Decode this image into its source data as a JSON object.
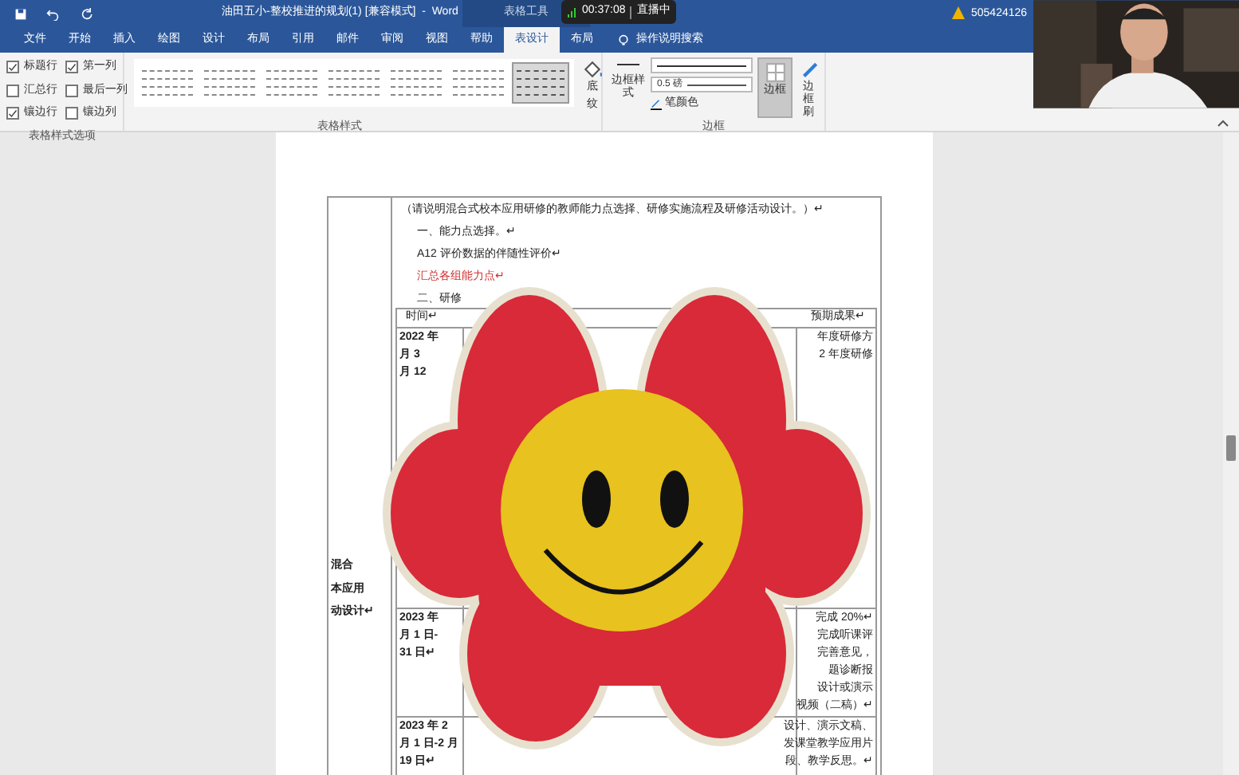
{
  "title_bar": {
    "title": "油田五小-整校推进的规划(1) [兼容模式]  -  Word",
    "context_tab": "表格工具",
    "recording": {
      "time": "00:37:08",
      "status": "直播中"
    },
    "account": "505424126"
  },
  "tabs": [
    {
      "label": "文件",
      "selected": false
    },
    {
      "label": "开始",
      "selected": false
    },
    {
      "label": "插入",
      "selected": false
    },
    {
      "label": "绘图",
      "selected": false
    },
    {
      "label": "设计",
      "selected": false
    },
    {
      "label": "布局",
      "selected": false
    },
    {
      "label": "引用",
      "selected": false
    },
    {
      "label": "邮件",
      "selected": false
    },
    {
      "label": "审阅",
      "selected": false
    },
    {
      "label": "视图",
      "selected": false
    },
    {
      "label": "帮助",
      "selected": false
    },
    {
      "label": "表设计",
      "selected": true
    },
    {
      "label": "布局",
      "selected": false
    }
  ],
  "search": {
    "placeholder": "操作说明搜索"
  },
  "ribbon": {
    "style_options": {
      "label": "表格样式选项",
      "items": [
        {
          "label": "标题行",
          "checked": true
        },
        {
          "label": "第一列",
          "checked": true
        },
        {
          "label": "汇总行",
          "checked": false
        },
        {
          "label": "最后一列",
          "checked": false
        },
        {
          "label": "镶边行",
          "checked": true
        },
        {
          "label": "镶边列",
          "checked": false
        }
      ]
    },
    "styles": {
      "label": "表格样式",
      "items": [
        {
          "selected": false
        },
        {
          "selected": false
        },
        {
          "selected": false
        },
        {
          "selected": false
        },
        {
          "selected": false
        },
        {
          "selected": false
        },
        {
          "selected": true
        }
      ],
      "shading": "底纹"
    },
    "borders": {
      "label": "边框",
      "border_styles": "边框样式",
      "weight": "0.5 磅",
      "pen_color": "笔颜色",
      "borders_button": {
        "label": "边框",
        "selected": true
      },
      "painter": "边框刷"
    }
  },
  "document": {
    "lines": [
      {
        "text": "（请说明混合式校本应用研修的教师能力点选择、研修实施流程及研修活动设计。）↵",
        "kind": "normal"
      },
      {
        "text": "一、能力点选择。↵",
        "kind": "indent"
      },
      {
        "text": "A12  评价数据的伴随性评价↵",
        "kind": "indent"
      },
      {
        "text": "汇总各组能力点↵",
        "kind": "red"
      },
      {
        "text": "二、研修",
        "kind": "indent"
      }
    ],
    "left_cell": [
      "混合",
      "本应用",
      "动设计↵"
    ],
    "header": [
      "时间↵",
      "预期成果↵"
    ],
    "rows": [
      {
        "time": [
          "2022 年",
          "月 3",
          "月 12"
        ],
        "result": [
          "年度研修方",
          "2 年度研修"
        ]
      },
      {
        "time": [
          "2023 年",
          "月 1 日-",
          "31 日↵"
        ],
        "result": [
          "完成 20%↵",
          "完成听课评",
          "完善意见，",
          "题诊断报",
          "设计或演示",
          "视频（二稿）↵"
        ]
      },
      {
        "time": [
          "2023 年 2",
          "月 1 日-2 月",
          "19 日↵"
        ],
        "result": [
          "设计、演示文稿、",
          "发课堂教学应用片",
          "段、教学反思。↵"
        ]
      }
    ]
  }
}
